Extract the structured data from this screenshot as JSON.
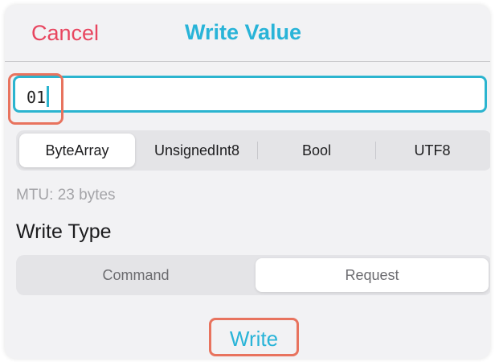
{
  "header": {
    "cancel_label": "Cancel",
    "title": "Write Value"
  },
  "input": {
    "value": "01"
  },
  "data_type": {
    "options": [
      "ByteArray",
      "UnsignedInt8",
      "Bool",
      "UTF8"
    ],
    "selected": "ByteArray"
  },
  "mtu_label": "MTU: 23 bytes",
  "write_type": {
    "heading": "Write Type",
    "options": [
      "Command",
      "Request"
    ],
    "selected": "Request"
  },
  "write_button_label": "Write",
  "colors": {
    "cancel": "#e8455f",
    "accent": "#29b4d8",
    "highlight": "#e8735e"
  }
}
